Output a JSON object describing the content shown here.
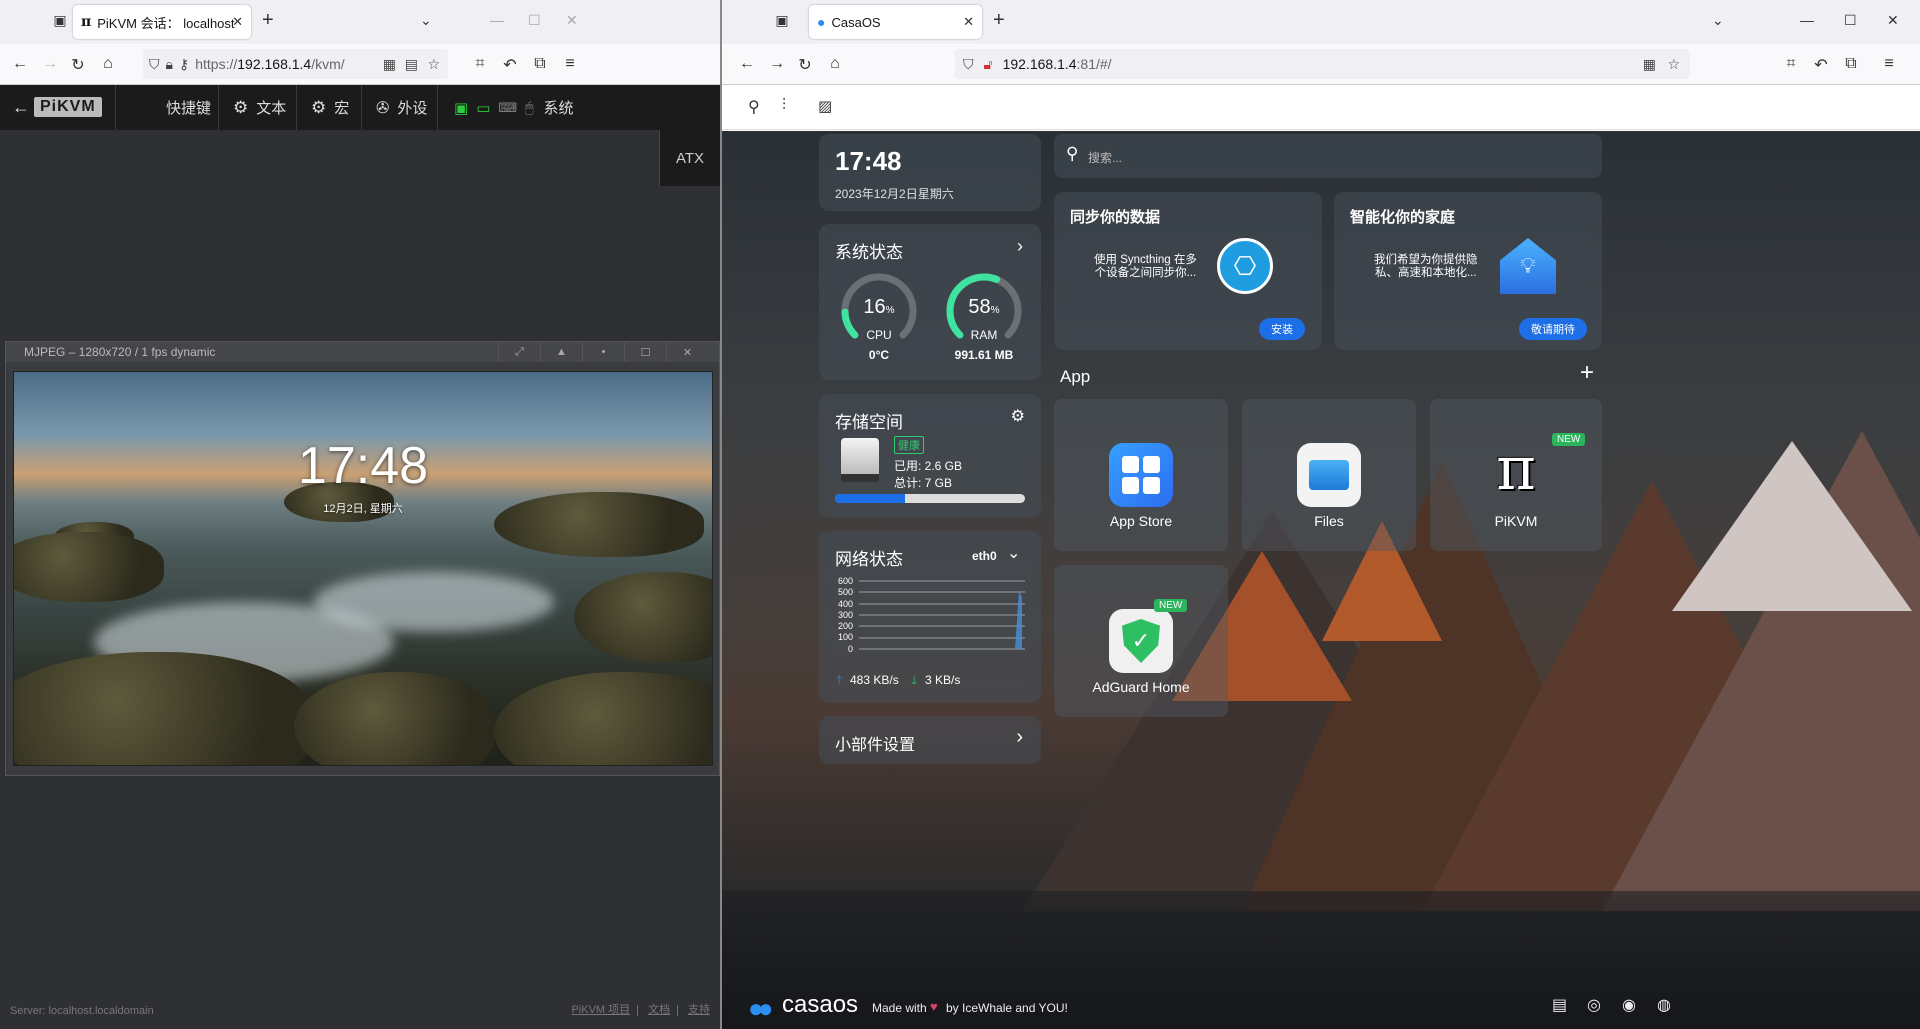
{
  "left": {
    "tab_title": "PiKVM 会话：  localhost.localc",
    "url_prefix": "https://",
    "url_host": "192.168.1.4",
    "url_path": "/kvm/",
    "kvm_menu": {
      "brand": "PiKVM",
      "shortcuts": "快捷键",
      "text": "文本",
      "macro": "宏",
      "peripherals": "外设",
      "system": "系统",
      "atx": "ATX"
    },
    "stream_title": "MJPEG – 1280x720 / 1 fps dynamic",
    "lock_time": "17:48",
    "lock_date": "12月2日, 星期六",
    "footer_server": "Server: localhost.localdomain",
    "footer_links": [
      "PiKVM 项目",
      "文档",
      "支持"
    ],
    "footer_sep": "|"
  },
  "right": {
    "tab_title": "CasaOS",
    "url_host": "192.168.1.4",
    "url_rest": ":81/#/",
    "clock_time": "17:48",
    "clock_date": "2023年12月2日星期六",
    "search_placeholder": "搜索...",
    "system_status": {
      "title": "系统状态",
      "cpu_value": "16",
      "cpu_unit": "%",
      "cpu_label": "CPU",
      "cpu_temp": "0°C",
      "cpu_percent": 16,
      "ram_value": "58",
      "ram_unit": "%",
      "ram_label": "RAM",
      "ram_used": "991.61 MB",
      "ram_percent": 58
    },
    "storage": {
      "title": "存储空间",
      "health": "健康",
      "used": "已用: 2.6 GB",
      "total": "总计: 7 GB",
      "used_fraction": 0.37
    },
    "network": {
      "title": "网络状态",
      "interface": "eth0",
      "yticks": [
        "600",
        "500",
        "400",
        "300",
        "200",
        "100",
        "0"
      ],
      "upload": "483 KB/s",
      "download": "3 KB/s"
    },
    "widget_settings": "小部件设置",
    "sync_card": {
      "title": "同步你的数据",
      "desc_line1": "使用 Syncthing 在多",
      "desc_line2": "个设备之间同步你...",
      "button": "安装"
    },
    "home_card": {
      "title": "智能化你的家庭",
      "desc_line1": "我们希望为你提供隐",
      "desc_line2": "私、高速和本地化...",
      "button": "敬请期待"
    },
    "app_section_title": "App",
    "apps": [
      {
        "label": "App Store"
      },
      {
        "label": "Files"
      },
      {
        "label": "PiKVM",
        "badge": "NEW"
      },
      {
        "label": "AdGuard Home",
        "badge": "NEW"
      }
    ],
    "footer": {
      "brand": "casaos",
      "made_with": "Made with",
      "by": "by IceWhale and YOU!"
    }
  },
  "colors": {
    "accent": "#1d6fe8",
    "gauge_green": "#3fe3a0",
    "new_badge": "#2db55d"
  }
}
